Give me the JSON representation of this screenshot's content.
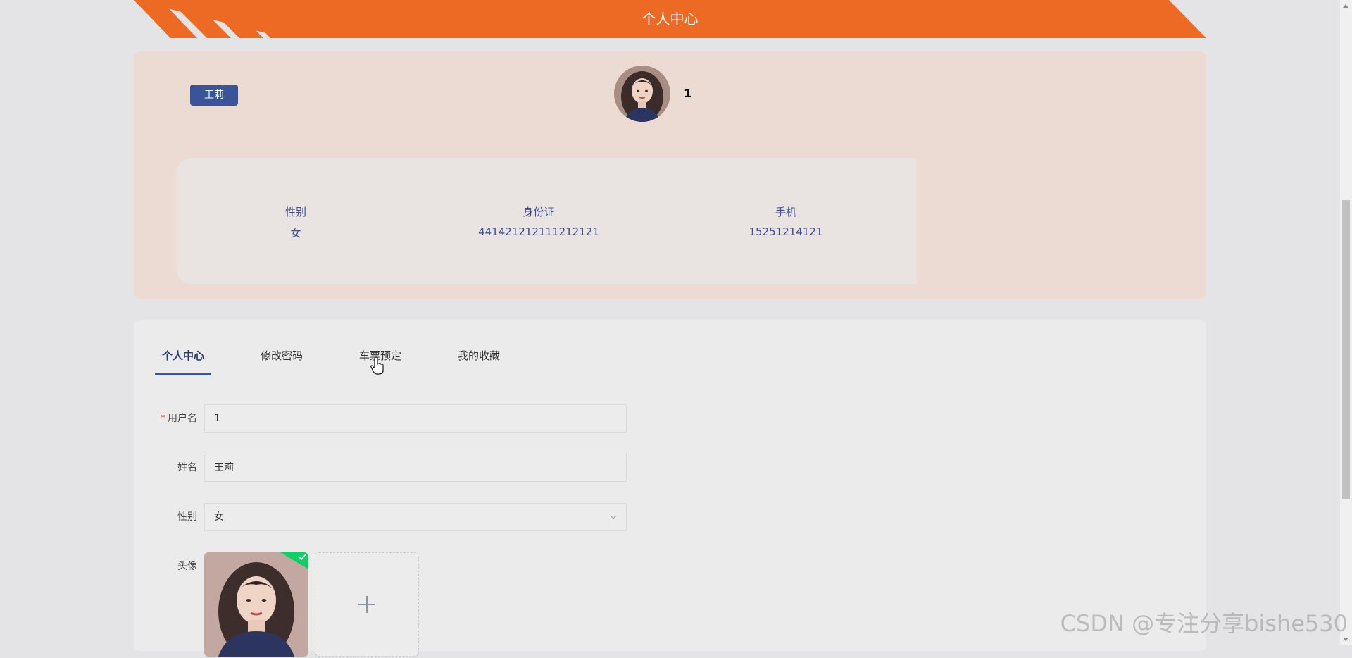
{
  "header": {
    "title": "个人中心"
  },
  "profile": {
    "name_badge": "王莉",
    "username": "1",
    "info": [
      {
        "label": "性别",
        "value": "女"
      },
      {
        "label": "身份证",
        "value": "441421212111212121"
      },
      {
        "label": "手机",
        "value": "15251214121"
      }
    ]
  },
  "tabs": [
    {
      "label": "个人中心",
      "active": true
    },
    {
      "label": "修改密码",
      "active": false
    },
    {
      "label": "车票预定",
      "active": false
    },
    {
      "label": "我的收藏",
      "active": false
    }
  ],
  "form": {
    "username": {
      "label": "用户名",
      "required_mark": "*",
      "value": "1"
    },
    "name": {
      "label": "姓名",
      "value": "王莉"
    },
    "gender": {
      "label": "性别",
      "value": "女"
    },
    "avatar": {
      "label": "头像"
    }
  },
  "watermark": "CSDN @专注分享bishe530",
  "colors": {
    "banner": "#ec6a24",
    "badge": "#3a5499",
    "profile_bg": "#ecdbd2",
    "page_bg": "#e4e3e6"
  },
  "icons": {
    "upload_status": "check-icon",
    "upload_add": "plus-icon",
    "select": "chevron-down-icon"
  }
}
